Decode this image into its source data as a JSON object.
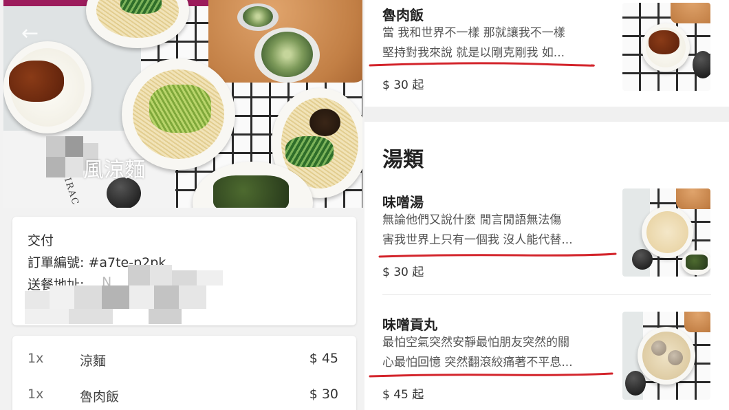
{
  "shop": {
    "back_icon": "back-arrow-icon",
    "name": "風涼麵"
  },
  "delivery": {
    "heading": "交付",
    "order_label": "訂單編號: #a7te-p2pk",
    "address_label": "送餐地址:",
    "address_hidden_partial": "N",
    "extra_hidden_partial": "La"
  },
  "order_items": [
    {
      "qty": "1x",
      "name": "涼麵",
      "price": "$ 45"
    },
    {
      "qty": "1x",
      "name": "魯肉飯",
      "price": "$ 30"
    }
  ],
  "menu": {
    "top_item": {
      "title": "魯肉飯",
      "desc": [
        "當 我和世界不一樣 那就讓我不一樣",
        "堅持對我來說 就是以剛克剛我 如..."
      ],
      "price": "$ 30 起"
    },
    "section_title": "湯類",
    "items": [
      {
        "title": "味噌湯",
        "desc": [
          "無論他們又說什麼 閒言閒語無法傷",
          "害我世界上只有一個我 沒人能代替..."
        ],
        "price": "$ 30 起"
      },
      {
        "title": "味噌貢丸",
        "desc": [
          "最怕空氣突然安靜最怕朋友突然的關",
          "心最怕回憶 突然翻滾絞痛著不平息..."
        ],
        "price": "$ 45 起"
      }
    ]
  },
  "colors": {
    "brand_bar": "#9c1c5c",
    "annotation_red": "#d3242b"
  }
}
